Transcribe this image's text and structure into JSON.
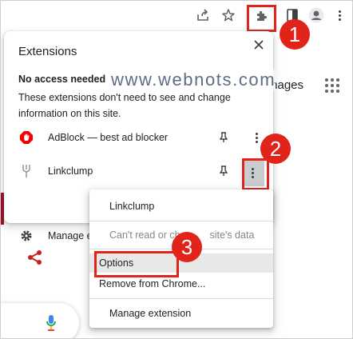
{
  "popup": {
    "title": "Extensions",
    "section_title": "No access needed",
    "section_desc": "These extensions don't need to see and change information on this site.",
    "extensions": [
      {
        "name": "AdBlock — best ad blocker",
        "icon": "adblock-icon"
      },
      {
        "name": "Linkclump",
        "icon": "linkclump-icon"
      }
    ],
    "manage_label": "Manage e"
  },
  "background": {
    "images_label": "mages"
  },
  "watermark": "www.webnots.com",
  "context_menu": {
    "header": "Linkclump",
    "permission": "Can't read or cha",
    "permission_tail": "site's data",
    "items": [
      "Options",
      "Remove from Chrome...",
      "Manage extension"
    ]
  },
  "badges": [
    "1",
    "2",
    "3"
  ],
  "colors": {
    "accent_red": "#e2231a",
    "adblock_red": "#f40000"
  }
}
